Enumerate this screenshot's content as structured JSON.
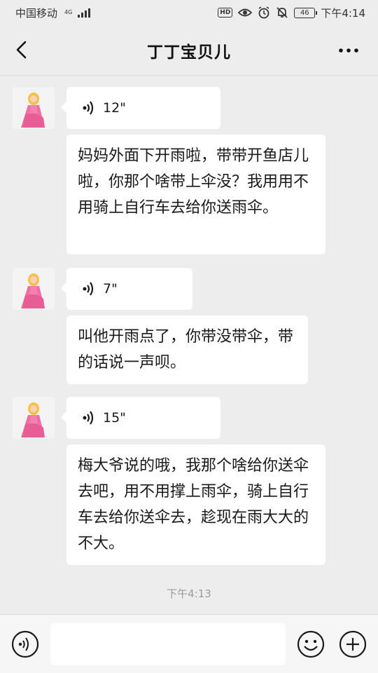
{
  "status_bar": {
    "carrier": "中国移动",
    "network": "4G",
    "hd_label": "HD",
    "battery": "46",
    "time": "下午4:14"
  },
  "header": {
    "title": "丁丁宝贝儿"
  },
  "messages": [
    {
      "type": "voice",
      "duration": "12\""
    },
    {
      "type": "text",
      "text": "妈妈外面下开雨啦，带带开鱼店儿啦，你那个啥带上伞没？我用用不用骑上自行车去给你送雨伞。"
    },
    {
      "type": "voice",
      "duration": "7\""
    },
    {
      "type": "text",
      "text": "叫他开雨点了，你带没带伞，带的话说一声呗。"
    },
    {
      "type": "voice",
      "duration": "15\""
    },
    {
      "type": "text",
      "text": "梅大爷说的哦，我那个啥给你送伞去吧，用不用撑上雨伞，骑上自行车去给你送伞去，趁现在雨大大的不大。"
    }
  ],
  "timestamp": "下午4:13",
  "icons": {
    "back": "chevron-left-icon",
    "more": "more-dots-icon",
    "voice": "voice-wave-icon",
    "emoji": "smiley-icon",
    "plus": "plus-icon"
  }
}
